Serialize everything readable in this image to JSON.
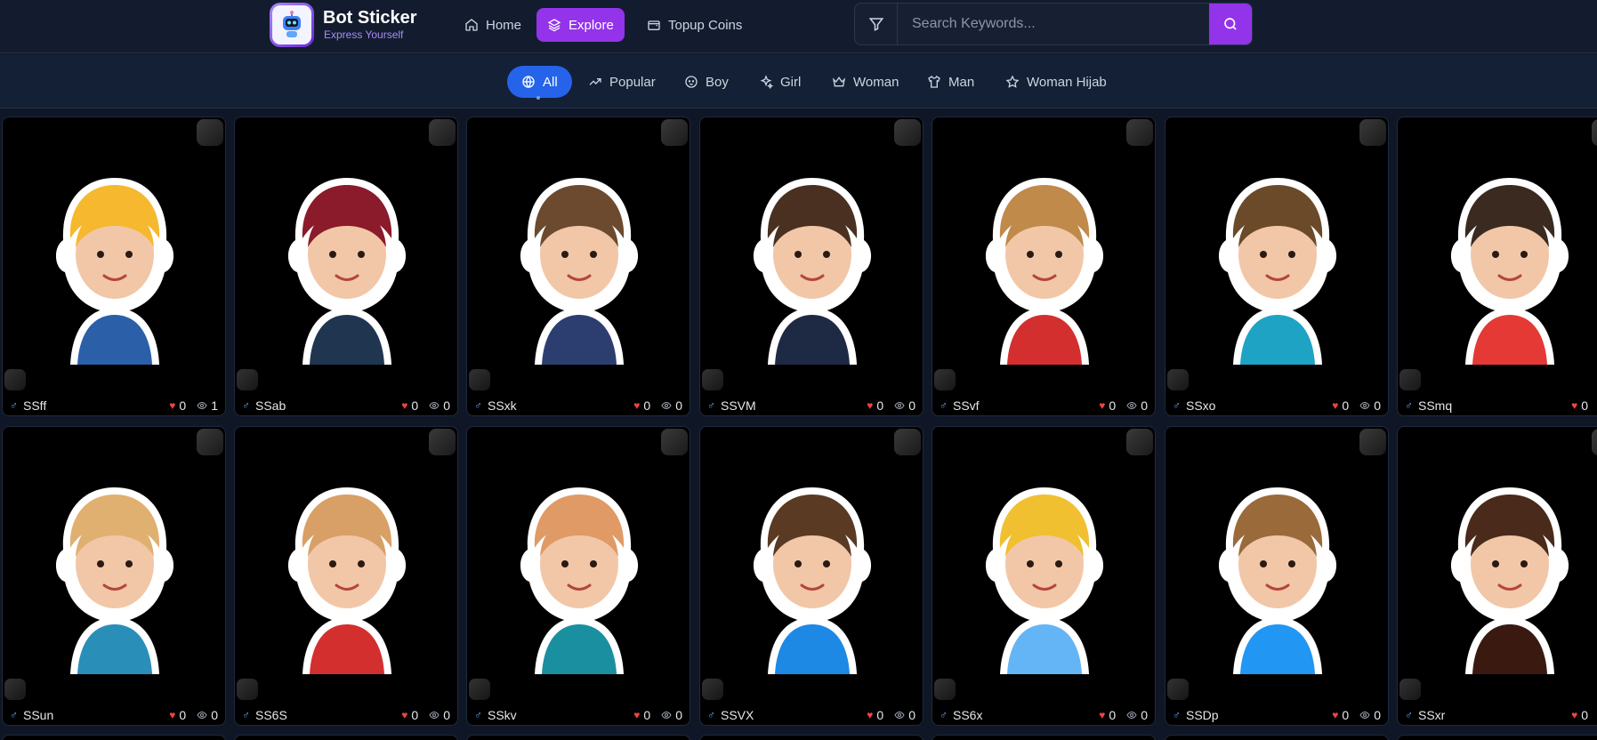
{
  "brand": {
    "name": "Bot Sticker",
    "tagline": "Express Yourself",
    "logo_icon": "robot-icon"
  },
  "nav": [
    {
      "label": "Home",
      "icon": "home-icon",
      "active": false
    },
    {
      "label": "Explore",
      "icon": "layers-icon",
      "active": true
    },
    {
      "label": "Topup Coins",
      "icon": "wallet-icon",
      "active": false
    }
  ],
  "search": {
    "placeholder": "Search Keywords...",
    "value": ""
  },
  "categories": [
    {
      "label": "All",
      "icon": "globe-icon",
      "active": true
    },
    {
      "label": "Popular",
      "icon": "trending-up-icon",
      "active": false
    },
    {
      "label": "Boy",
      "icon": "baby-icon",
      "active": false
    },
    {
      "label": "Girl",
      "icon": "sparkles-icon",
      "active": false
    },
    {
      "label": "Woman",
      "icon": "crown-icon",
      "active": false
    },
    {
      "label": "Man",
      "icon": "shirt-icon",
      "active": false
    },
    {
      "label": "Woman Hijab",
      "icon": "star-icon",
      "active": false
    }
  ],
  "stickers": [
    {
      "name": "SSff",
      "likes": "0",
      "views": "1",
      "gender_icon": "male-icon",
      "bg": "#f5b82e",
      "accent": "#2b5fa8"
    },
    {
      "name": "SSab",
      "likes": "0",
      "views": "0",
      "gender_icon": "male-icon",
      "bg": "#8b1a2a",
      "accent": "#1f3550"
    },
    {
      "name": "SSxk",
      "likes": "0",
      "views": "0",
      "gender_icon": "male-icon",
      "bg": "#6b4a2f",
      "accent": "#2c3e70"
    },
    {
      "name": "SSVM",
      "likes": "0",
      "views": "0",
      "gender_icon": "male-icon",
      "bg": "#4a3020",
      "accent": "#1e2a44"
    },
    {
      "name": "SSvf",
      "likes": "0",
      "views": "0",
      "gender_icon": "male-icon",
      "bg": "#c08a4a",
      "accent": "#d32f2f"
    },
    {
      "name": "SSxo",
      "likes": "0",
      "views": "0",
      "gender_icon": "male-icon",
      "bg": "#6b4a2a",
      "accent": "#1fa3c4"
    },
    {
      "name": "SSmq",
      "likes": "0",
      "views": "",
      "gender_icon": "male-icon",
      "bg": "#3a2a20",
      "accent": "#e53935"
    },
    {
      "name": "SSun",
      "likes": "0",
      "views": "0",
      "gender_icon": "male-icon",
      "bg": "#e0b070",
      "accent": "#2a8fb8"
    },
    {
      "name": "SS6S",
      "likes": "0",
      "views": "0",
      "gender_icon": "male-icon",
      "bg": "#d8a066",
      "accent": "#d32f2f"
    },
    {
      "name": "SSkv",
      "likes": "0",
      "views": "0",
      "gender_icon": "male-icon",
      "bg": "#e09a66",
      "accent": "#1a8fa0"
    },
    {
      "name": "SSVX",
      "likes": "0",
      "views": "0",
      "gender_icon": "male-icon",
      "bg": "#5a3a22",
      "accent": "#1e88e5"
    },
    {
      "name": "SS6x",
      "likes": "0",
      "views": "0",
      "gender_icon": "male-icon",
      "bg": "#f0c030",
      "accent": "#64b5f6"
    },
    {
      "name": "SSDp",
      "likes": "0",
      "views": "0",
      "gender_icon": "male-icon",
      "bg": "#9a6a3a",
      "accent": "#2196f3"
    },
    {
      "name": "SSxr",
      "likes": "0",
      "views": "",
      "gender_icon": "male-icon",
      "bg": "#4a2a1a",
      "accent": "#3a1a10"
    }
  ]
}
